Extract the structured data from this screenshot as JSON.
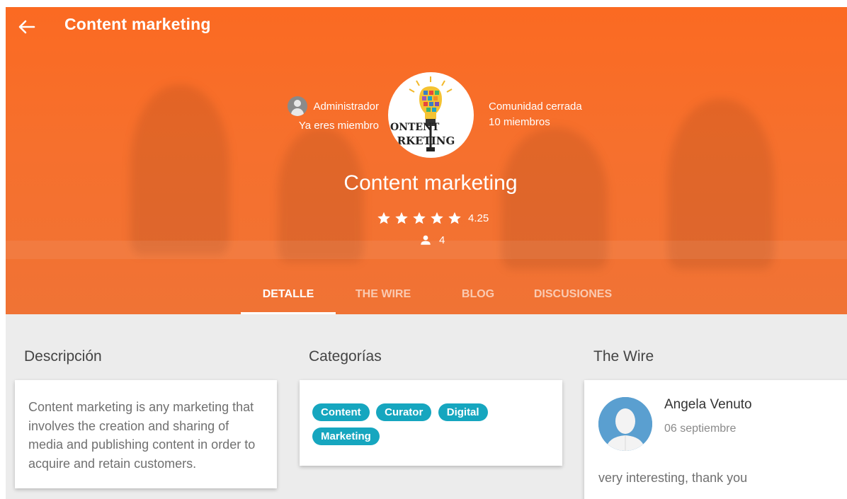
{
  "header": {
    "title": "Content marketing",
    "back_icon": "arrow-left-icon"
  },
  "hero": {
    "admin": {
      "role": "Administrador",
      "status": "Ya eres miembro"
    },
    "logo": {
      "line1": "ONTENT",
      "line2": "ARKETING"
    },
    "community": {
      "type": "Comunidad cerrada",
      "members": "10 miembros"
    },
    "title": "Content marketing",
    "rating": {
      "value": "4.25",
      "stars": 5
    },
    "member_count": "4"
  },
  "tabs": [
    {
      "label": "DETALLE",
      "active": true
    },
    {
      "label": "THE WIRE",
      "active": false
    },
    {
      "label": "BLOG",
      "active": false
    },
    {
      "label": "DISCUSIONES",
      "active": false
    }
  ],
  "description": {
    "title": "Descripción",
    "text": "Content marketing is any marketing that involves the creation and sharing of media and publishing content in order to acquire and retain customers."
  },
  "categories": {
    "title": "Categorías",
    "chips": [
      "Content",
      "Curator",
      "Digital",
      "Marketing"
    ]
  },
  "wire": {
    "title": "The Wire",
    "post": {
      "author": "Angela Venuto",
      "date": "06 septiembre",
      "message": "very interesting, thank you"
    }
  },
  "colors": {
    "accent": "#fb6a22",
    "chip": "#16a6bf"
  }
}
